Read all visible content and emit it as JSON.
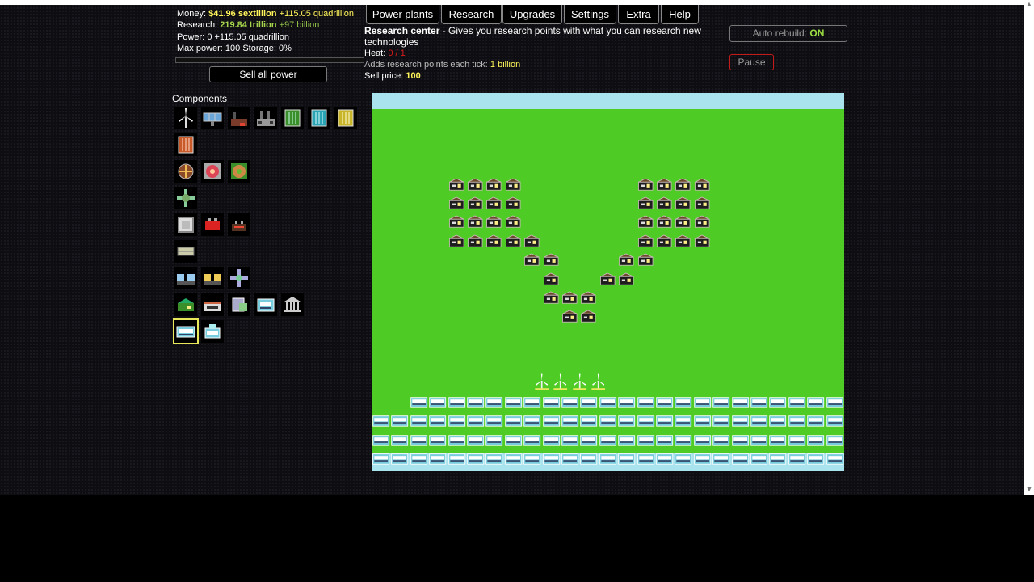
{
  "stats": {
    "money_label": "Money:",
    "money_value": "$41.96 sextillion",
    "money_delta": "+115.05 quadrillion",
    "research_label": "Research:",
    "research_value": "219.84 trillion",
    "research_delta": "+97 billion",
    "power_label": "Power:",
    "power_value": "0",
    "power_delta": "+115.05 quadrillion",
    "maxpower_label": "Max power:",
    "maxpower_value": "100",
    "storage_label": "Storage:",
    "storage_value": "0%"
  },
  "progress": 0,
  "sell_button": "Sell all power",
  "nav": [
    "Power plants",
    "Research",
    "Upgrades",
    "Settings",
    "Extra",
    "Help"
  ],
  "info": {
    "title": "Research center",
    "description": " - Gives you research points with what you can research new technologies",
    "heat_label": "Heat:",
    "heat_value": "0 / 1",
    "research_label": "Adds research points each tick:",
    "research_value": "1 billion",
    "price_label": "Sell price:",
    "price_value": "100"
  },
  "auto_rebuild": {
    "label": "Auto rebuild:",
    "value": "ON"
  },
  "pause_label": "Pause",
  "components_title": "Components",
  "components": [
    {
      "row": 0,
      "col": 0,
      "icon": "wind-turbine-icon"
    },
    {
      "row": 0,
      "col": 1,
      "icon": "solar-panel-icon"
    },
    {
      "row": 0,
      "col": 2,
      "icon": "coal-plant-icon"
    },
    {
      "row": 0,
      "col": 3,
      "icon": "factory-icon"
    },
    {
      "row": 0,
      "col": 4,
      "icon": "green-battery-icon"
    },
    {
      "row": 0,
      "col": 5,
      "icon": "cyan-battery-icon"
    },
    {
      "row": 0,
      "col": 6,
      "icon": "yellow-battery-icon"
    },
    {
      "row": 1,
      "col": 0,
      "icon": "orange-battery-icon"
    },
    {
      "row": 2,
      "col": 0,
      "icon": "heat-vent-icon"
    },
    {
      "row": 2,
      "col": 1,
      "icon": "fan-vent-icon"
    },
    {
      "row": 2,
      "col": 2,
      "icon": "green-vent-icon"
    },
    {
      "row": 3,
      "col": 0,
      "icon": "heat-exchanger-icon"
    },
    {
      "row": 4,
      "col": 0,
      "icon": "heat-plate-icon"
    },
    {
      "row": 4,
      "col": 1,
      "icon": "red-pump-icon"
    },
    {
      "row": 4,
      "col": 2,
      "icon": "dark-pump-icon"
    },
    {
      "row": 5,
      "col": 0,
      "icon": "isolator-icon"
    },
    {
      "row": 6,
      "col": 0,
      "icon": "blue-duo-icon"
    },
    {
      "row": 6,
      "col": 1,
      "icon": "yellow-duo-icon"
    },
    {
      "row": 6,
      "col": 2,
      "icon": "cross-exchanger-icon"
    },
    {
      "row": 7,
      "col": 0,
      "icon": "green-house-icon"
    },
    {
      "row": 7,
      "col": 1,
      "icon": "shop-icon"
    },
    {
      "row": 7,
      "col": 2,
      "icon": "office-icon"
    },
    {
      "row": 7,
      "col": 3,
      "icon": "lab-icon"
    },
    {
      "row": 7,
      "col": 4,
      "icon": "bank-icon"
    },
    {
      "row": 8,
      "col": 0,
      "icon": "research-center-icon",
      "selected": true
    },
    {
      "row": 8,
      "col": 1,
      "icon": "advanced-lab-icon"
    }
  ],
  "board": {
    "cols": 25,
    "rows": 20,
    "houses": [
      [
        9,
        4
      ],
      [
        10,
        4
      ],
      [
        11,
        4
      ],
      [
        12,
        4
      ],
      [
        9,
        5
      ],
      [
        10,
        5
      ],
      [
        11,
        5
      ],
      [
        12,
        5
      ],
      [
        9,
        6
      ],
      [
        10,
        6
      ],
      [
        11,
        6
      ],
      [
        12,
        6
      ],
      [
        9,
        7
      ],
      [
        10,
        7
      ],
      [
        11,
        7
      ],
      [
        12,
        7
      ],
      [
        13,
        7
      ],
      [
        13,
        8
      ],
      [
        14,
        8
      ],
      [
        14,
        9
      ],
      [
        14,
        10
      ],
      [
        15,
        10
      ],
      [
        16,
        10
      ],
      [
        15,
        11
      ],
      [
        16,
        11
      ],
      [
        19,
        4
      ],
      [
        20,
        4
      ],
      [
        21,
        4
      ],
      [
        22,
        4
      ],
      [
        19,
        5
      ],
      [
        20,
        5
      ],
      [
        21,
        5
      ],
      [
        22,
        5
      ],
      [
        19,
        6
      ],
      [
        20,
        6
      ],
      [
        21,
        6
      ],
      [
        22,
        6
      ],
      [
        19,
        7
      ],
      [
        20,
        7
      ],
      [
        21,
        7
      ],
      [
        22,
        7
      ],
      [
        18,
        8
      ],
      [
        19,
        8
      ],
      [
        17,
        9
      ],
      [
        18,
        9
      ]
    ],
    "turbines": [
      [
        9,
        14
      ],
      [
        10,
        14
      ],
      [
        11,
        14
      ],
      [
        12,
        14
      ]
    ],
    "labs_row14_from_col": 2,
    "lab_rows_full": [
      15,
      16,
      17
    ]
  },
  "colors": {
    "grass": "#4fcb26",
    "water": "#a9e4ee",
    "money": "#fff45a",
    "research": "#a6d64b",
    "heat": "#d91a1a",
    "pause_border": "#c41a1a"
  }
}
